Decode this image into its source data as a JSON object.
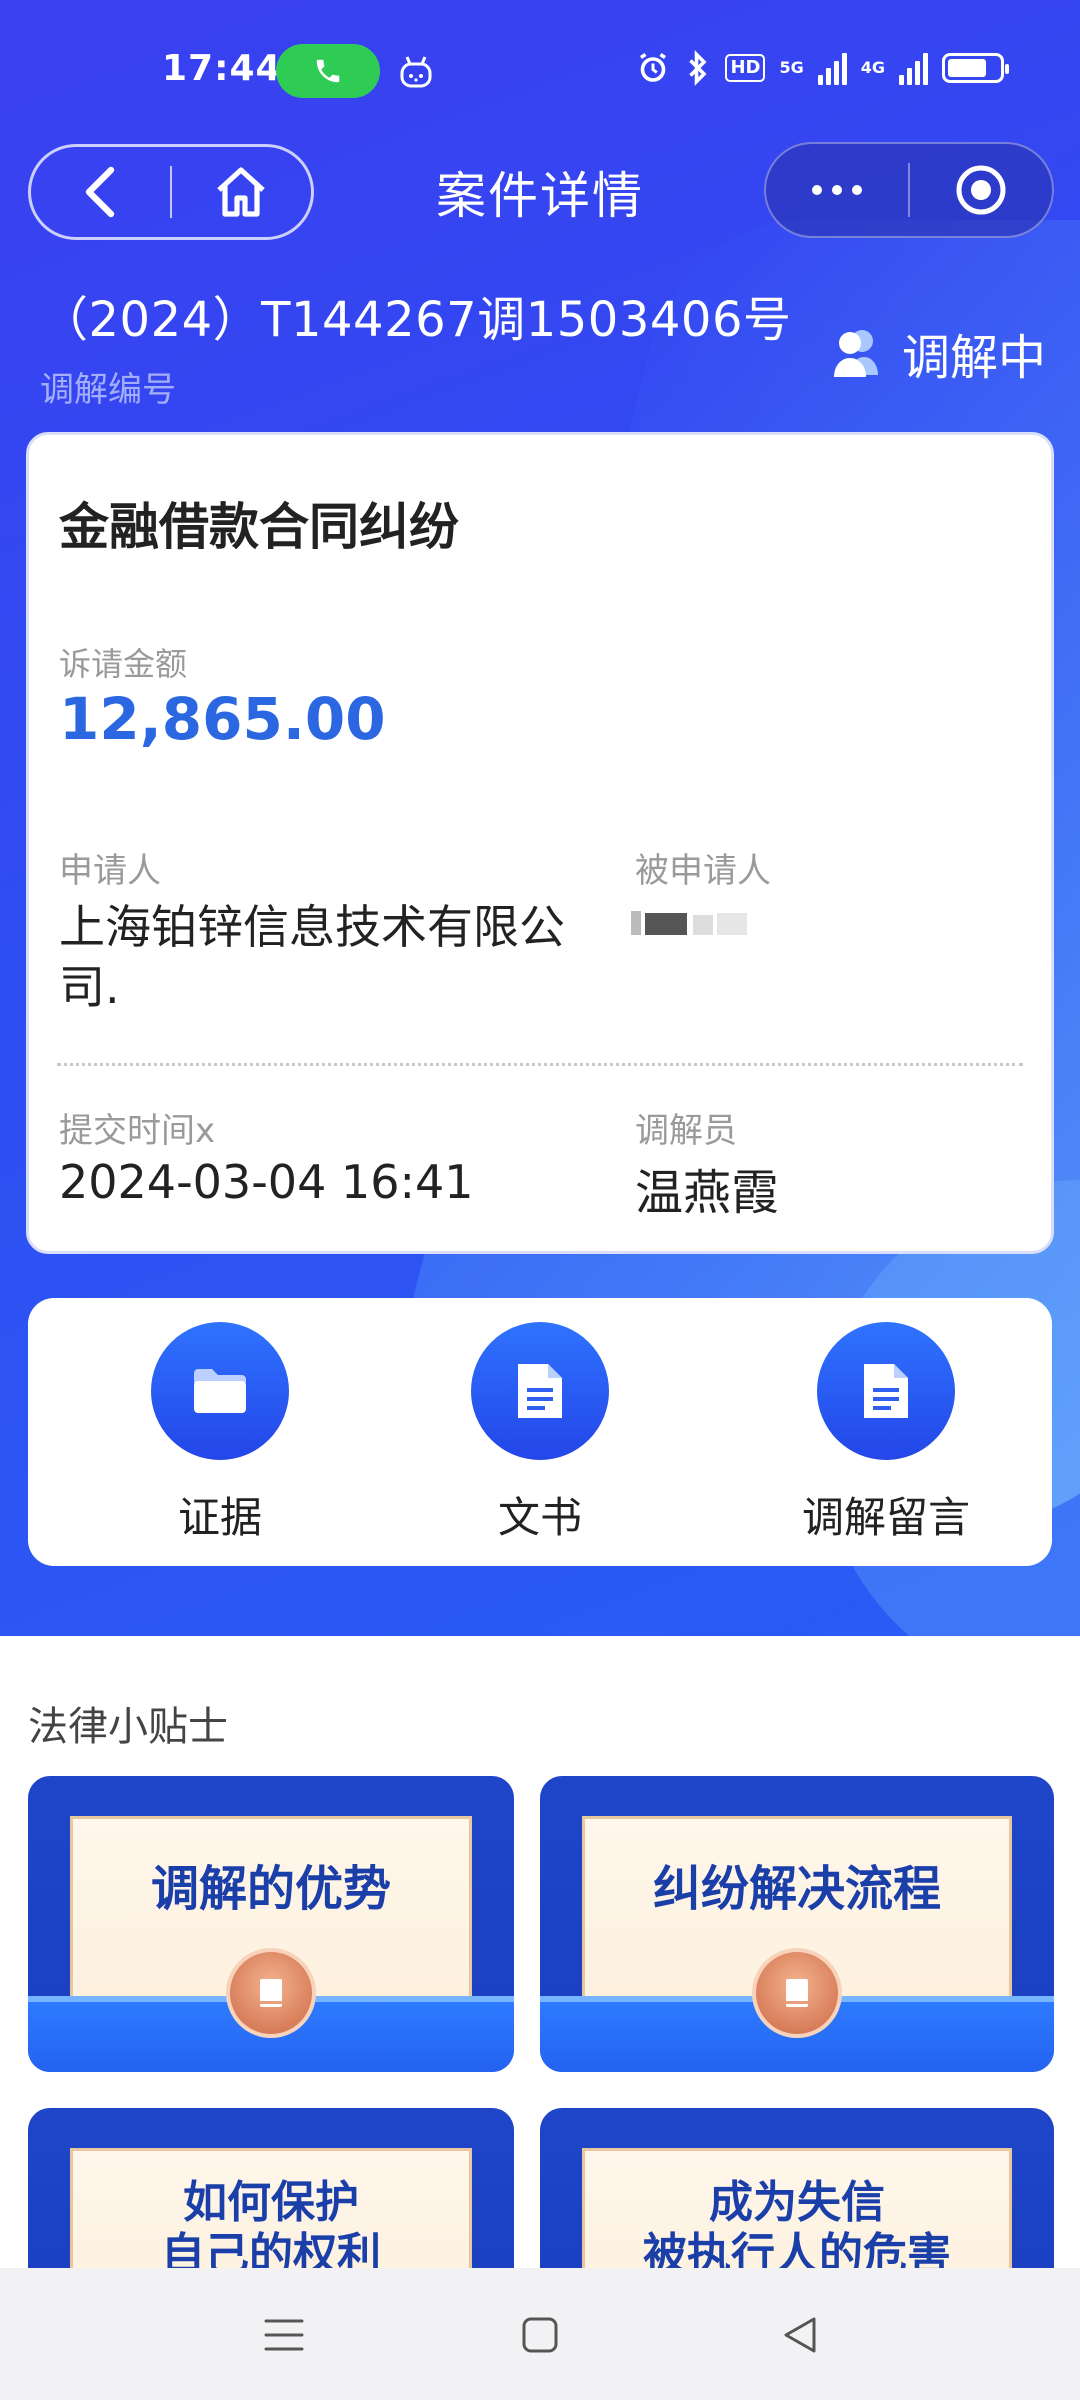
{
  "status_bar": {
    "time": "17:44",
    "hd_label": "HD",
    "net_5g": "5G",
    "net_4g": "4G",
    "battery_level": 0.7,
    "call_pill_color": "#2ecc55"
  },
  "nav": {
    "title": "案件详情",
    "back_icon": "chevron-left-icon",
    "home_icon": "home-icon",
    "more_icon": "more-dots-icon",
    "close_icon": "target-circle-icon"
  },
  "case": {
    "number": "（2024）T144267调1503406号",
    "number_label": "调解编号",
    "status": "调解中",
    "type": "金融借款合同纠纷",
    "amount_label": "诉请金额",
    "amount": "12,865.00",
    "applicant_label": "申请人",
    "applicant": "上海铂锌信息技术有限公司.",
    "respondent_label": "被申请人",
    "submit_label": "提交时间x",
    "submit_time": "2024-03-04 16:41",
    "mediator_label": "调解员",
    "mediator": "温燕霞"
  },
  "actions": [
    {
      "label": "证据",
      "icon": "folder-icon"
    },
    {
      "label": "文书",
      "icon": "document-icon"
    },
    {
      "label": "调解留言",
      "icon": "document-icon"
    }
  ],
  "tips": {
    "title": "法律小贴士",
    "items": [
      {
        "line1": "调解的优势",
        "line2": ""
      },
      {
        "line1": "纠纷解决流程",
        "line2": ""
      },
      {
        "line1": "如何保护",
        "line2": "自己的权利"
      },
      {
        "line1": "成为失信",
        "line2": "被执行人的危害"
      }
    ]
  },
  "colors": {
    "brand_blue": "#2f4df2",
    "amount_blue": "#2a67e0",
    "tip_title": "#1b3fa8"
  }
}
